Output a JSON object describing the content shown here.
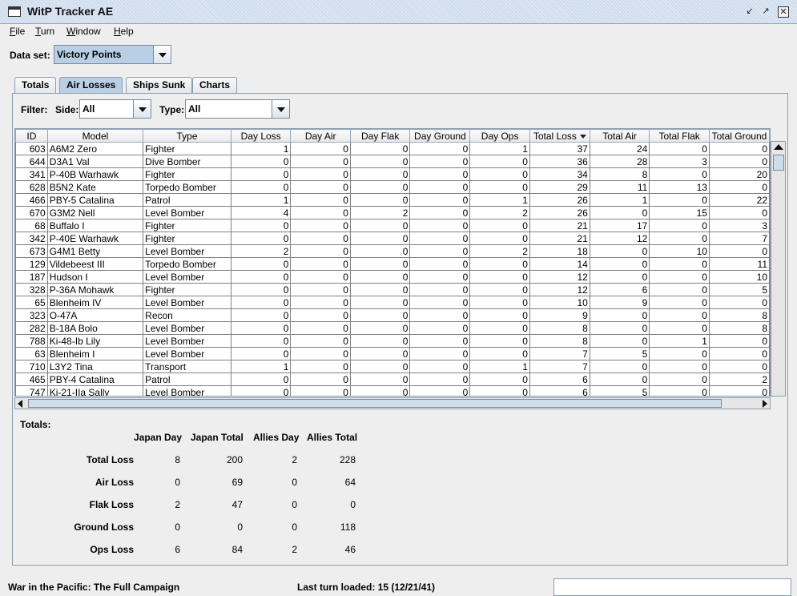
{
  "window": {
    "title": "WitP Tracker AE"
  },
  "menu": {
    "items": [
      "File",
      "Turn",
      "Window",
      "Help"
    ]
  },
  "dataset": {
    "label": "Data set:",
    "value": "Victory Points"
  },
  "tabs": [
    "Totals",
    "Air Losses",
    "Ships Sunk",
    "Charts"
  ],
  "active_tab": "Air Losses",
  "filter": {
    "label": "Filter:",
    "side_label": "Side:",
    "side_value": "All",
    "type_label": "Type:",
    "type_value": "All"
  },
  "table": {
    "columns": [
      "ID",
      "Model",
      "Type",
      "Day Loss",
      "Day Air",
      "Day Flak",
      "Day Ground",
      "Day Ops",
      "Total Loss",
      "Total Air",
      "Total Flak",
      "Total Ground"
    ],
    "sorted_column": "Total Loss",
    "rows": [
      [
        "603",
        "A6M2 Zero",
        "Fighter",
        "1",
        "0",
        "0",
        "0",
        "1",
        "37",
        "24",
        "0",
        "0"
      ],
      [
        "644",
        "D3A1 Val",
        "Dive Bomber",
        "0",
        "0",
        "0",
        "0",
        "0",
        "36",
        "28",
        "3",
        "0"
      ],
      [
        "341",
        "P-40B Warhawk",
        "Fighter",
        "0",
        "0",
        "0",
        "0",
        "0",
        "34",
        "8",
        "0",
        "20"
      ],
      [
        "628",
        "B5N2 Kate",
        "Torpedo Bomber",
        "0",
        "0",
        "0",
        "0",
        "0",
        "29",
        "11",
        "13",
        "0"
      ],
      [
        "466",
        "PBY-5 Catalina",
        "Patrol",
        "1",
        "0",
        "0",
        "0",
        "1",
        "26",
        "1",
        "0",
        "22"
      ],
      [
        "670",
        "G3M2 Nell",
        "Level Bomber",
        "4",
        "0",
        "2",
        "0",
        "2",
        "26",
        "0",
        "15",
        "0"
      ],
      [
        "68",
        "Buffalo I",
        "Fighter",
        "0",
        "0",
        "0",
        "0",
        "0",
        "21",
        "17",
        "0",
        "3"
      ],
      [
        "342",
        "P-40E Warhawk",
        "Fighter",
        "0",
        "0",
        "0",
        "0",
        "0",
        "21",
        "12",
        "0",
        "7"
      ],
      [
        "673",
        "G4M1 Betty",
        "Level Bomber",
        "2",
        "0",
        "0",
        "0",
        "2",
        "18",
        "0",
        "10",
        "0"
      ],
      [
        "129",
        "Vildebeest III",
        "Torpedo Bomber",
        "0",
        "0",
        "0",
        "0",
        "0",
        "14",
        "0",
        "0",
        "11"
      ],
      [
        "187",
        "Hudson I",
        "Level Bomber",
        "0",
        "0",
        "0",
        "0",
        "0",
        "12",
        "0",
        "0",
        "10"
      ],
      [
        "328",
        "P-36A Mohawk",
        "Fighter",
        "0",
        "0",
        "0",
        "0",
        "0",
        "12",
        "6",
        "0",
        "5"
      ],
      [
        "65",
        "Blenheim IV",
        "Level Bomber",
        "0",
        "0",
        "0",
        "0",
        "0",
        "10",
        "9",
        "0",
        "0"
      ],
      [
        "323",
        "O-47A",
        "Recon",
        "0",
        "0",
        "0",
        "0",
        "0",
        "9",
        "0",
        "0",
        "8"
      ],
      [
        "282",
        "B-18A Bolo",
        "Level Bomber",
        "0",
        "0",
        "0",
        "0",
        "0",
        "8",
        "0",
        "0",
        "8"
      ],
      [
        "788",
        "Ki-48-Ib Lily",
        "Level Bomber",
        "0",
        "0",
        "0",
        "0",
        "0",
        "8",
        "0",
        "1",
        "0"
      ],
      [
        "63",
        "Blenheim I",
        "Level Bomber",
        "0",
        "0",
        "0",
        "0",
        "0",
        "7",
        "5",
        "0",
        "0"
      ],
      [
        "710",
        "L3Y2 Tina",
        "Transport",
        "1",
        "0",
        "0",
        "0",
        "1",
        "7",
        "0",
        "0",
        "0"
      ],
      [
        "465",
        "PBY-4 Catalina",
        "Patrol",
        "0",
        "0",
        "0",
        "0",
        "0",
        "6",
        "0",
        "0",
        "2"
      ],
      [
        "747",
        "Ki-21-IIa Sally",
        "Level Bomber",
        "0",
        "0",
        "0",
        "0",
        "0",
        "6",
        "5",
        "0",
        "0"
      ]
    ]
  },
  "totals": {
    "label": "Totals:",
    "columns": [
      "Japan Day",
      "Japan Total",
      "Allies Day",
      "Allies Total"
    ],
    "rows": [
      {
        "label": "Total Loss",
        "values": [
          "8",
          "200",
          "2",
          "228"
        ]
      },
      {
        "label": "Air Loss",
        "values": [
          "0",
          "69",
          "0",
          "64"
        ]
      },
      {
        "label": "Flak Loss",
        "values": [
          "2",
          "47",
          "0",
          "0"
        ]
      },
      {
        "label": "Ground Loss",
        "values": [
          "0",
          "0",
          "0",
          "118"
        ]
      },
      {
        "label": "Ops Loss",
        "values": [
          "6",
          "84",
          "2",
          "46"
        ]
      }
    ]
  },
  "status": {
    "campaign": "War in the Pacific: The Full Campaign",
    "last_turn": "Last turn loaded: 15 (12/21/41)"
  }
}
